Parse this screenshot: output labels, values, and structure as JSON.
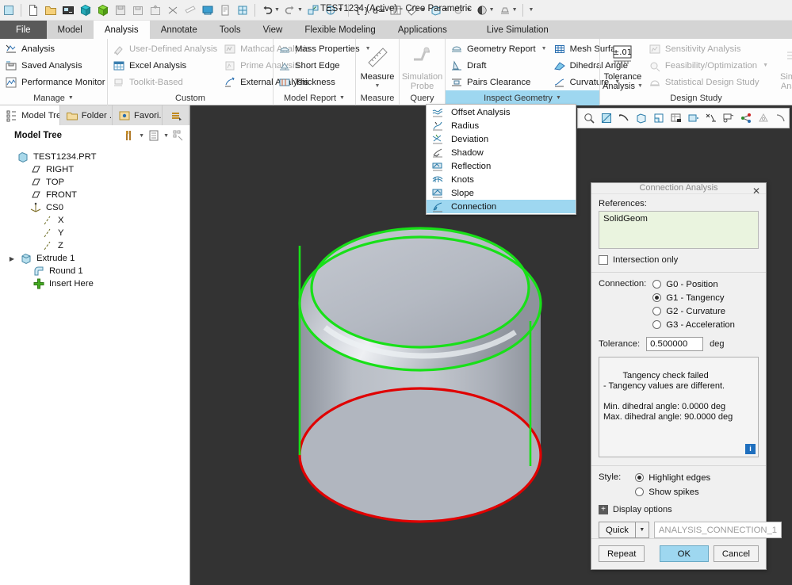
{
  "window": {
    "title": "TEST1234 (Active) - Creo Parametric"
  },
  "quick_access": {
    "icons": [
      "new-window-icon",
      "new-file-icon",
      "open-file-icon",
      "open-from-session-icon",
      "save-icon",
      "save-as-icon",
      "save-a-copy-icon",
      "save-backup-icon",
      "close-icon",
      "print-icon",
      "erase-icon",
      "export-icon",
      "regenerate-icon",
      "undo-icon",
      "redo-icon",
      "repaint-icon",
      "refit-icon",
      "parameters-icon",
      "dimension-icon",
      "table-icon",
      "measure-icon",
      "view-manager-icon",
      "appearance-icon",
      "render-icon",
      "overflow-icon"
    ]
  },
  "tabs": [
    {
      "label": "File",
      "state": "file"
    },
    {
      "label": "Model",
      "state": "normal"
    },
    {
      "label": "Analysis",
      "state": "active"
    },
    {
      "label": "Annotate",
      "state": "normal"
    },
    {
      "label": "Tools",
      "state": "normal"
    },
    {
      "label": "View",
      "state": "normal"
    },
    {
      "label": "Flexible Modeling",
      "state": "normal"
    },
    {
      "label": "Applications",
      "state": "normal"
    },
    {
      "label": "Live Simulation",
      "state": "normal"
    }
  ],
  "ribbon": {
    "groups": [
      {
        "label": "Manage",
        "has_dropdown": true,
        "highlight": false,
        "columns": [
          {
            "items": [
              {
                "label": "Analysis",
                "icon": "analysis-icon",
                "disabled": false
              },
              {
                "label": "Saved Analysis",
                "icon": "saved-analysis-icon",
                "disabled": false
              },
              {
                "label": "Performance Monitor",
                "icon": "performance-monitor-icon",
                "disabled": false
              }
            ]
          }
        ]
      },
      {
        "label": "Custom",
        "has_dropdown": false,
        "highlight": false,
        "columns": [
          {
            "items": [
              {
                "label": "User-Defined Analysis",
                "icon": "user-defined-analysis-icon",
                "disabled": true
              },
              {
                "label": "Excel Analysis",
                "icon": "excel-analysis-icon",
                "disabled": false
              },
              {
                "label": "Toolkit-Based",
                "icon": "toolkit-based-icon",
                "disabled": true
              }
            ]
          },
          {
            "items": [
              {
                "label": "Mathcad Analysis",
                "icon": "mathcad-analysis-icon",
                "disabled": true
              },
              {
                "label": "Prime Analysis",
                "icon": "prime-analysis-icon",
                "disabled": true
              },
              {
                "label": "External Analysis",
                "icon": "external-analysis-icon",
                "disabled": false
              }
            ]
          }
        ]
      },
      {
        "label": "Model Report",
        "has_dropdown": true,
        "highlight": false,
        "columns": [
          {
            "items": [
              {
                "label": "Mass Properties",
                "icon": "mass-properties-icon",
                "disabled": false,
                "dropdown": true
              },
              {
                "label": "Short Edge",
                "icon": "short-edge-icon",
                "disabled": false
              },
              {
                "label": "Thickness",
                "icon": "thickness-icon",
                "disabled": false
              }
            ]
          }
        ]
      },
      {
        "label": "Measure",
        "has_dropdown": false,
        "highlight": false,
        "big": [
          {
            "label": "Measure",
            "icon": "ruler-icon",
            "disabled": false,
            "dropdown": true
          }
        ]
      },
      {
        "label": "Query",
        "has_dropdown": false,
        "highlight": false,
        "big": [
          {
            "label": "Simulation Probe",
            "icon": "simulation-probe-icon",
            "disabled": true
          }
        ]
      },
      {
        "label": "Inspect Geometry",
        "has_dropdown": true,
        "highlight": true,
        "columns": [
          {
            "items": [
              {
                "label": "Geometry Report",
                "icon": "geometry-report-icon",
                "disabled": false,
                "dropdown": true
              },
              {
                "label": "Draft",
                "icon": "draft-icon",
                "disabled": false
              },
              {
                "label": "Pairs Clearance",
                "icon": "pairs-clearance-icon",
                "disabled": false
              }
            ]
          },
          {
            "items": [
              {
                "label": "Mesh Surface",
                "icon": "mesh-surface-icon",
                "disabled": false
              },
              {
                "label": "Dihedral Angle",
                "icon": "dihedral-angle-icon",
                "disabled": false
              },
              {
                "label": "Curvature",
                "icon": "curvature-icon",
                "disabled": false,
                "dropdown": true
              }
            ]
          }
        ]
      },
      {
        "label": "Design Study",
        "has_dropdown": false,
        "highlight": false,
        "big": [
          {
            "label": "Tolerance Analysis",
            "icon": "tolerance-analysis-icon",
            "disabled": false,
            "dropdown": true
          }
        ],
        "columns": [
          {
            "items": [
              {
                "label": "Sensitivity Analysis",
                "icon": "sensitivity-analysis-icon",
                "disabled": true
              },
              {
                "label": "Feasibility/Optimization",
                "icon": "feasibility-optimization-icon",
                "disabled": true,
                "dropdown": true
              },
              {
                "label": "Statistical Design Study",
                "icon": "statistical-design-study-icon",
                "disabled": true
              }
            ]
          }
        ],
        "big2": [
          {
            "label": "Simulate Analysis",
            "icon": "simulate-analysis-icon",
            "disabled": true
          }
        ]
      }
    ]
  },
  "navigator": {
    "tabs": [
      {
        "label": "Model Tree",
        "icon": "model-tree-icon",
        "active": true
      },
      {
        "label": "Folder ...",
        "icon": "folder-browser-icon",
        "active": false
      },
      {
        "label": "Favori...",
        "icon": "favorites-icon",
        "active": false
      },
      {
        "label": "",
        "icon": "layers-icon",
        "active": false
      }
    ],
    "toolbar": {
      "title": "Model Tree",
      "settings_icon": "tools-icon",
      "display_icon": "display-list-icon",
      "filter_icon": "tree-filter-icon"
    },
    "tree": [
      {
        "label": "TEST1234.PRT",
        "icon": "part-icon",
        "indent": 0,
        "expander": ""
      },
      {
        "label": "RIGHT",
        "icon": "datum-plane-icon",
        "indent": 1,
        "expander": ""
      },
      {
        "label": "TOP",
        "icon": "datum-plane-icon",
        "indent": 1,
        "expander": ""
      },
      {
        "label": "FRONT",
        "icon": "datum-plane-icon",
        "indent": 1,
        "expander": ""
      },
      {
        "label": "CS0",
        "icon": "coordinate-system-icon",
        "indent": 1,
        "expander": ""
      },
      {
        "label": "X",
        "icon": "datum-axis-icon",
        "indent": 2,
        "expander": ""
      },
      {
        "label": "Y",
        "icon": "datum-axis-icon",
        "indent": 2,
        "expander": ""
      },
      {
        "label": "Z",
        "icon": "datum-axis-icon",
        "indent": 2,
        "expander": ""
      },
      {
        "label": "Extrude 1",
        "icon": "extrude-icon",
        "indent": 1,
        "expander": "▶"
      },
      {
        "label": "Round 1",
        "icon": "round-icon",
        "indent": 1,
        "expander": ""
      },
      {
        "label": "Insert Here",
        "icon": "insert-here-icon",
        "indent": 1,
        "expander": ""
      }
    ]
  },
  "graphics_toolbar": {
    "icons": [
      "zoom-icon",
      "repaint-icon",
      "spin-center-icon",
      "datum-display-icon",
      "view-style-icon",
      "saved-views-icon",
      "view-manager-icon",
      "annotation-display-icon",
      "layers-icon",
      "appearance-gallery-icon",
      "perspective-icon",
      "more-icon"
    ]
  },
  "inspect_menu": {
    "header": "Inspect Geometry",
    "items": [
      {
        "label": "Offset Analysis",
        "icon": "offset-analysis-icon",
        "selected": false
      },
      {
        "label": "Radius",
        "icon": "radius-icon",
        "selected": false
      },
      {
        "label": "Deviation",
        "icon": "deviation-icon",
        "selected": false
      },
      {
        "label": "Shadow",
        "icon": "shadow-icon",
        "selected": false
      },
      {
        "label": "Reflection",
        "icon": "reflection-icon",
        "selected": false
      },
      {
        "label": "Knots",
        "icon": "knots-icon",
        "selected": false
      },
      {
        "label": "Slope",
        "icon": "slope-icon",
        "selected": false
      },
      {
        "label": "Connection",
        "icon": "connection-icon",
        "selected": true
      }
    ]
  },
  "dialog": {
    "title": "Connection Analysis",
    "close_label": "✕",
    "references_label": "References:",
    "references_value": "SolidGeom",
    "intersection_only_label": "Intersection only",
    "intersection_only_checked": false,
    "connection_label": "Connection:",
    "connection_options": [
      {
        "label": "G0 - Position",
        "selected": false
      },
      {
        "label": "G1 - Tangency",
        "selected": true
      },
      {
        "label": "G2 - Curvature",
        "selected": false
      },
      {
        "label": "G3 - Acceleration",
        "selected": false
      }
    ],
    "tolerance_label": "Tolerance:",
    "tolerance_value": "0.500000",
    "tolerance_unit": "deg",
    "result_text": "Tangency check failed\n- Tangency values are different.\n\nMin. dihedral angle: 0.0000 deg\nMax. dihedral angle: 90.0000 deg",
    "info_label": "i",
    "style_label": "Style:",
    "style_options": [
      {
        "label": "Highlight edges",
        "selected": true
      },
      {
        "label": "Show spikes",
        "selected": false
      }
    ],
    "display_options_label": "Display options",
    "display_options_toggle": "+",
    "mode_value": "Quick",
    "analysis_name_placeholder": "ANALYSIS_CONNECTION_1",
    "buttons": {
      "repeat": "Repeat",
      "ok": "OK",
      "cancel": "Cancel"
    }
  },
  "colors": {
    "accent_blue": "#9ed7f0",
    "viewport_bg": "#333333",
    "tangent_edge_green": "#00e000",
    "failed_edge_red": "#e00000",
    "model_gray": "#b6bac2",
    "ref_field_green": "#eaf4df"
  }
}
